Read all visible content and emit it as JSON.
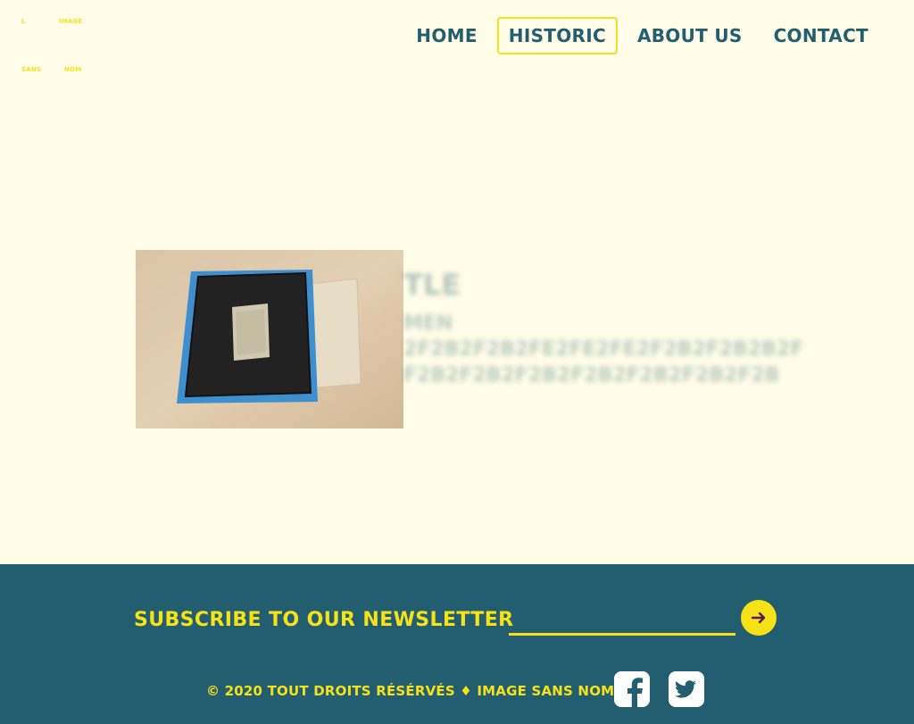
{
  "logo": {
    "words": [
      "L",
      "IMAGE",
      "SANS",
      "NOM"
    ]
  },
  "nav": {
    "items": [
      {
        "label": "HOME"
      },
      {
        "label": "HISTORIC"
      },
      {
        "label": "ABOUT US"
      },
      {
        "label": "CONTACT"
      }
    ],
    "active": "HISTORIC"
  },
  "article": {
    "title": "TLE",
    "lines": [
      "MEN",
      "2F2B2F2B2FE2FE2FE2F2B2F2B2B2F",
      "F2B2F2B2F2B2F2B2F2B2F2B2F2B"
    ]
  },
  "footer": {
    "newsletter_label": "SUBSCRIBE TO OUR NEWSLETTER",
    "email_placeholder": "",
    "copyright": "© 2020 TOUT DROITS RÉSÉRVÉS ♦ IMAGE SANS NOM"
  },
  "colors": {
    "background": "#fffde8",
    "accent": "#f5e218",
    "primary": "#235e70"
  },
  "icons": [
    "arrow-right-icon",
    "facebook-icon",
    "twitter-icon"
  ]
}
